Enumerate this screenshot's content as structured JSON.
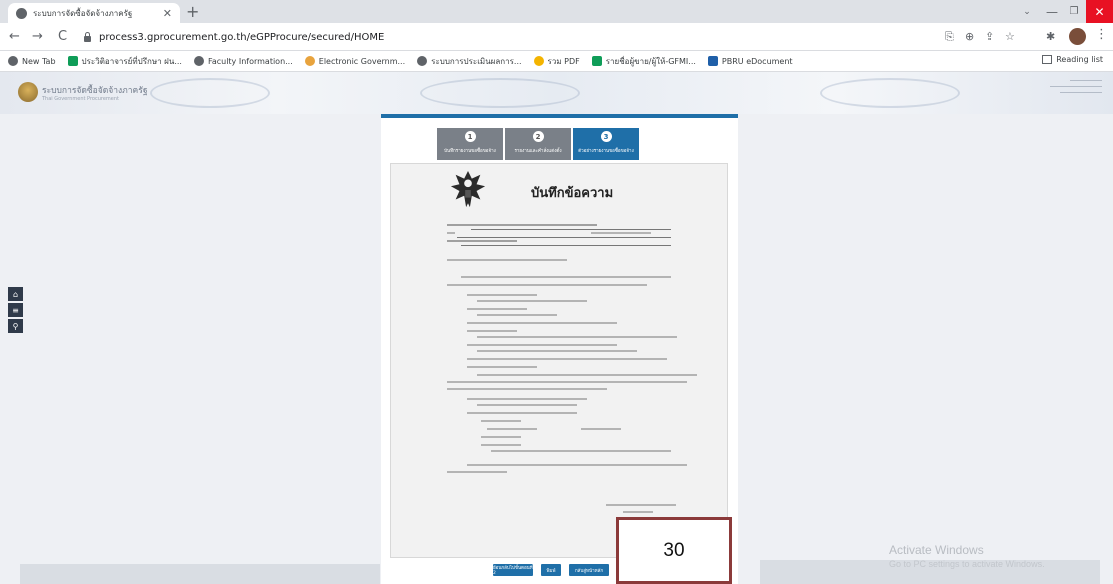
{
  "browser": {
    "tab_title": "ระบบการจัดซื้อจัดจ้างภาครัฐ",
    "new_tab": "+",
    "back": "←",
    "forward": "→",
    "reload": "C",
    "url": "process3.gprocurement.go.th/eGPProcure/secured/HOME",
    "window": {
      "list": "⌄",
      "minimize": "—",
      "maximize": "❐",
      "close": "✕"
    },
    "bookmarks": [
      {
        "label": "New Tab",
        "icon": "globe-icon",
        "color": "#5f6368",
        "square": false
      },
      {
        "label": "ประวิติอาจารย์ที่ปรึกษา ฝน...",
        "icon": "plus-square-icon",
        "color": "#0f9d58",
        "square": true
      },
      {
        "label": "Faculty Information...",
        "icon": "globe-icon",
        "color": "#5f6368",
        "square": false
      },
      {
        "label": "Electronic Governm...",
        "icon": "leaf-icon",
        "color": "#e8a33d",
        "square": false
      },
      {
        "label": "ระบบการประเมินผลการ...",
        "icon": "globe-icon",
        "color": "#5f6368",
        "square": false
      },
      {
        "label": "รวม PDF",
        "icon": "dots-icon",
        "color": "#f4b400",
        "square": false
      },
      {
        "label": "รายชื่อผู้ขาย/ผู้ให้-GFMI...",
        "icon": "plus-square-icon",
        "color": "#0f9d58",
        "square": true
      },
      {
        "label": "PBRU eDocument",
        "icon": "doc-icon",
        "color": "#1f5fa8",
        "square": true
      }
    ],
    "reading_list": "Reading list"
  },
  "site": {
    "title": "ระบบการจัดซื้อจัดจ้างภาครัฐ",
    "subtitle": "Thai Government Procurement"
  },
  "left_toolbar": [
    {
      "name": "home-icon",
      "glyph": "⌂"
    },
    {
      "name": "menu-icon",
      "glyph": "≡"
    },
    {
      "name": "search-icon",
      "glyph": "⚲"
    }
  ],
  "steps": [
    {
      "num": "1",
      "label": "บันทึกรายงานขอซื้อขอจ้าง",
      "active": false
    },
    {
      "num": "2",
      "label": "รายงานและคำสั่งแต่งตั้ง",
      "active": false
    },
    {
      "num": "3",
      "label": "ตัวอย่างรายงานขอซื้อขอจ้าง",
      "active": true
    }
  ],
  "memo": {
    "title": "บันทึกข้อความ"
  },
  "actions": [
    {
      "label": "ย้อนกลับไปขั้นตอนที่ 2",
      "name": "back-to-step2-button"
    },
    {
      "label": "พิมพ์",
      "name": "print-button"
    },
    {
      "label": "กลับสู่หน้าหลัก",
      "name": "home-page-button"
    }
  ],
  "slide_number": "30",
  "watermark": {
    "line1": "Activate Windows",
    "line2": "Go to PC settings to activate Windows."
  }
}
